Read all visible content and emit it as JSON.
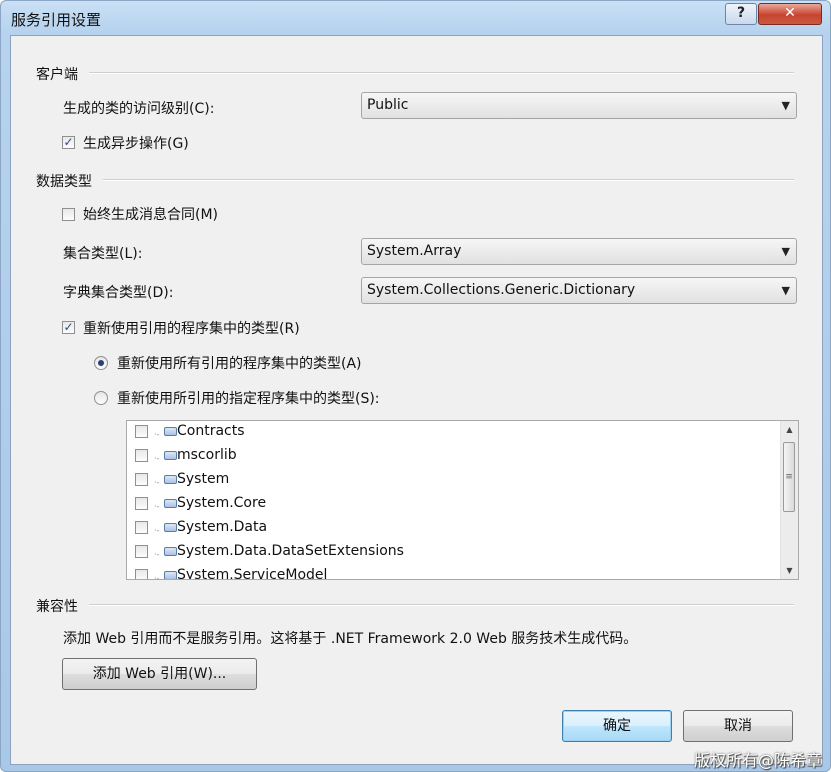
{
  "window": {
    "title": "服务引用设置",
    "help_glyph": "?",
    "close_glyph": "✕"
  },
  "client_section": {
    "header": "客户端",
    "access_level_label": "生成的类的访问级别(C):",
    "access_level_value": "Public",
    "async_label": "生成异步操作(G)",
    "async_checked": true
  },
  "data_type_section": {
    "header": "数据类型",
    "always_generate_label": "始终生成消息合同(M)",
    "always_generate_checked": false,
    "collection_type_label": "集合类型(L):",
    "collection_type_value": "System.Array",
    "dictionary_type_label": "字典集合类型(D):",
    "dictionary_type_value": "System.Collections.Generic.Dictionary",
    "reuse_types_label": "重新使用引用的程序集中的类型(R)",
    "reuse_types_checked": true,
    "reuse_all_label": "重新使用所有引用的程序集中的类型(A)",
    "reuse_all_selected": true,
    "reuse_specified_label": "重新使用所引用的指定程序集中的类型(S):",
    "reuse_specified_selected": false,
    "assemblies": [
      {
        "name": "Contracts",
        "checked": false
      },
      {
        "name": "mscorlib",
        "checked": false
      },
      {
        "name": "System",
        "checked": false
      },
      {
        "name": "System.Core",
        "checked": false
      },
      {
        "name": "System.Data",
        "checked": false
      },
      {
        "name": "System.Data.DataSetExtensions",
        "checked": false
      },
      {
        "name": "System.ServiceModel",
        "checked": false
      }
    ]
  },
  "compat_section": {
    "header": "兼容性",
    "description": "添加 Web 引用而不是服务引用。这将基于 .NET Framework 2.0 Web 服务技术生成代码。",
    "add_web_ref_button": "添加 Web 引用(W)..."
  },
  "footer": {
    "ok_button": "确定",
    "cancel_button": "取消"
  },
  "watermark": "版权所有@陈希章",
  "icons": {
    "checkmark": "✓",
    "dropdown_arrow": "▼",
    "scroll_up": "▲",
    "scroll_down": "▼",
    "scroll_grip": "≡"
  }
}
